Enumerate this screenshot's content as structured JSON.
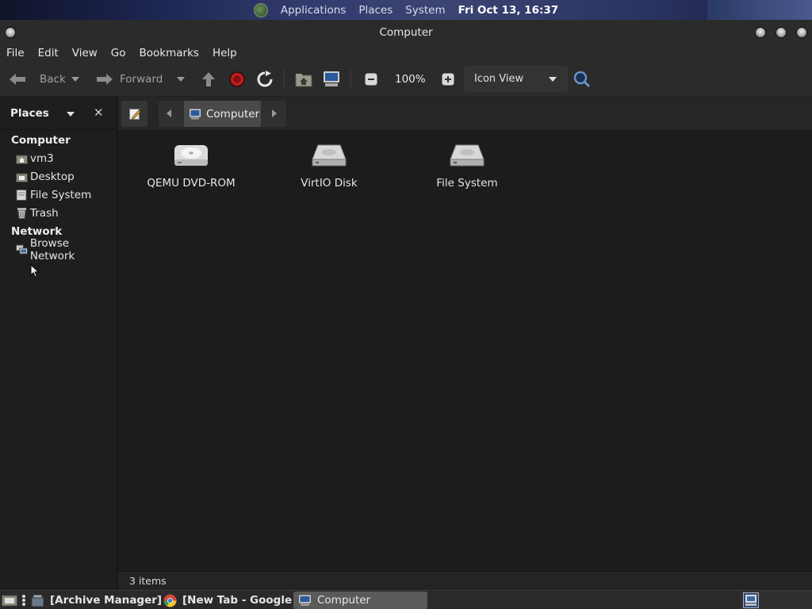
{
  "top_panel": {
    "menus": [
      "Applications",
      "Places",
      "System"
    ],
    "clock": "Fri Oct 13, 16:37"
  },
  "window": {
    "title": "Computer"
  },
  "menubar": [
    "File",
    "Edit",
    "View",
    "Go",
    "Bookmarks",
    "Help"
  ],
  "toolbar": {
    "back": "Back",
    "forward": "Forward",
    "zoom": "100%",
    "view_mode": "Icon View"
  },
  "sidebar": {
    "title": "Places",
    "close": "✕",
    "sections": [
      {
        "name": "Computer",
        "items": [
          {
            "label": "vm3",
            "icon": "home-folder-icon"
          },
          {
            "label": "Desktop",
            "icon": "desktop-folder-icon"
          },
          {
            "label": "File System",
            "icon": "filesystem-icon"
          },
          {
            "label": "Trash",
            "icon": "trash-icon"
          }
        ]
      },
      {
        "name": "Network",
        "items": [
          {
            "label": "Browse Network",
            "icon": "network-icon"
          }
        ]
      }
    ]
  },
  "location": {
    "crumb": "Computer"
  },
  "content": {
    "items": [
      {
        "label": "QEMU DVD-ROM",
        "icon": "optical-drive-icon"
      },
      {
        "label": "VirtIO Disk",
        "icon": "hard-disk-icon"
      },
      {
        "label": "File System",
        "icon": "hard-disk-icon"
      }
    ]
  },
  "statusbar": {
    "text": "3 items"
  },
  "taskbar": {
    "tasks": [
      "[Archive Manager]",
      "[New Tab - Google ...",
      "Computer"
    ]
  }
}
